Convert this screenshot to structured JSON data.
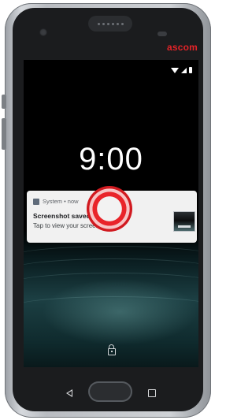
{
  "device": {
    "brand": "ascom",
    "brand_color": "#e42328"
  },
  "status_bar": {
    "icons": [
      "wifi-icon",
      "cellular-signal-icon",
      "battery-icon"
    ]
  },
  "lock_screen": {
    "time": "9:00"
  },
  "notification": {
    "app_icon": "system-app-icon",
    "header": "System • now",
    "title": "Screenshot saved",
    "text": "Tap to view your screenshot",
    "thumbnail": "screenshot-thumbnail"
  },
  "tap_indicator": {
    "color": "#e9242a"
  },
  "nav_bar": {
    "icons": [
      "back-icon",
      "home-button",
      "recents-icon"
    ]
  }
}
